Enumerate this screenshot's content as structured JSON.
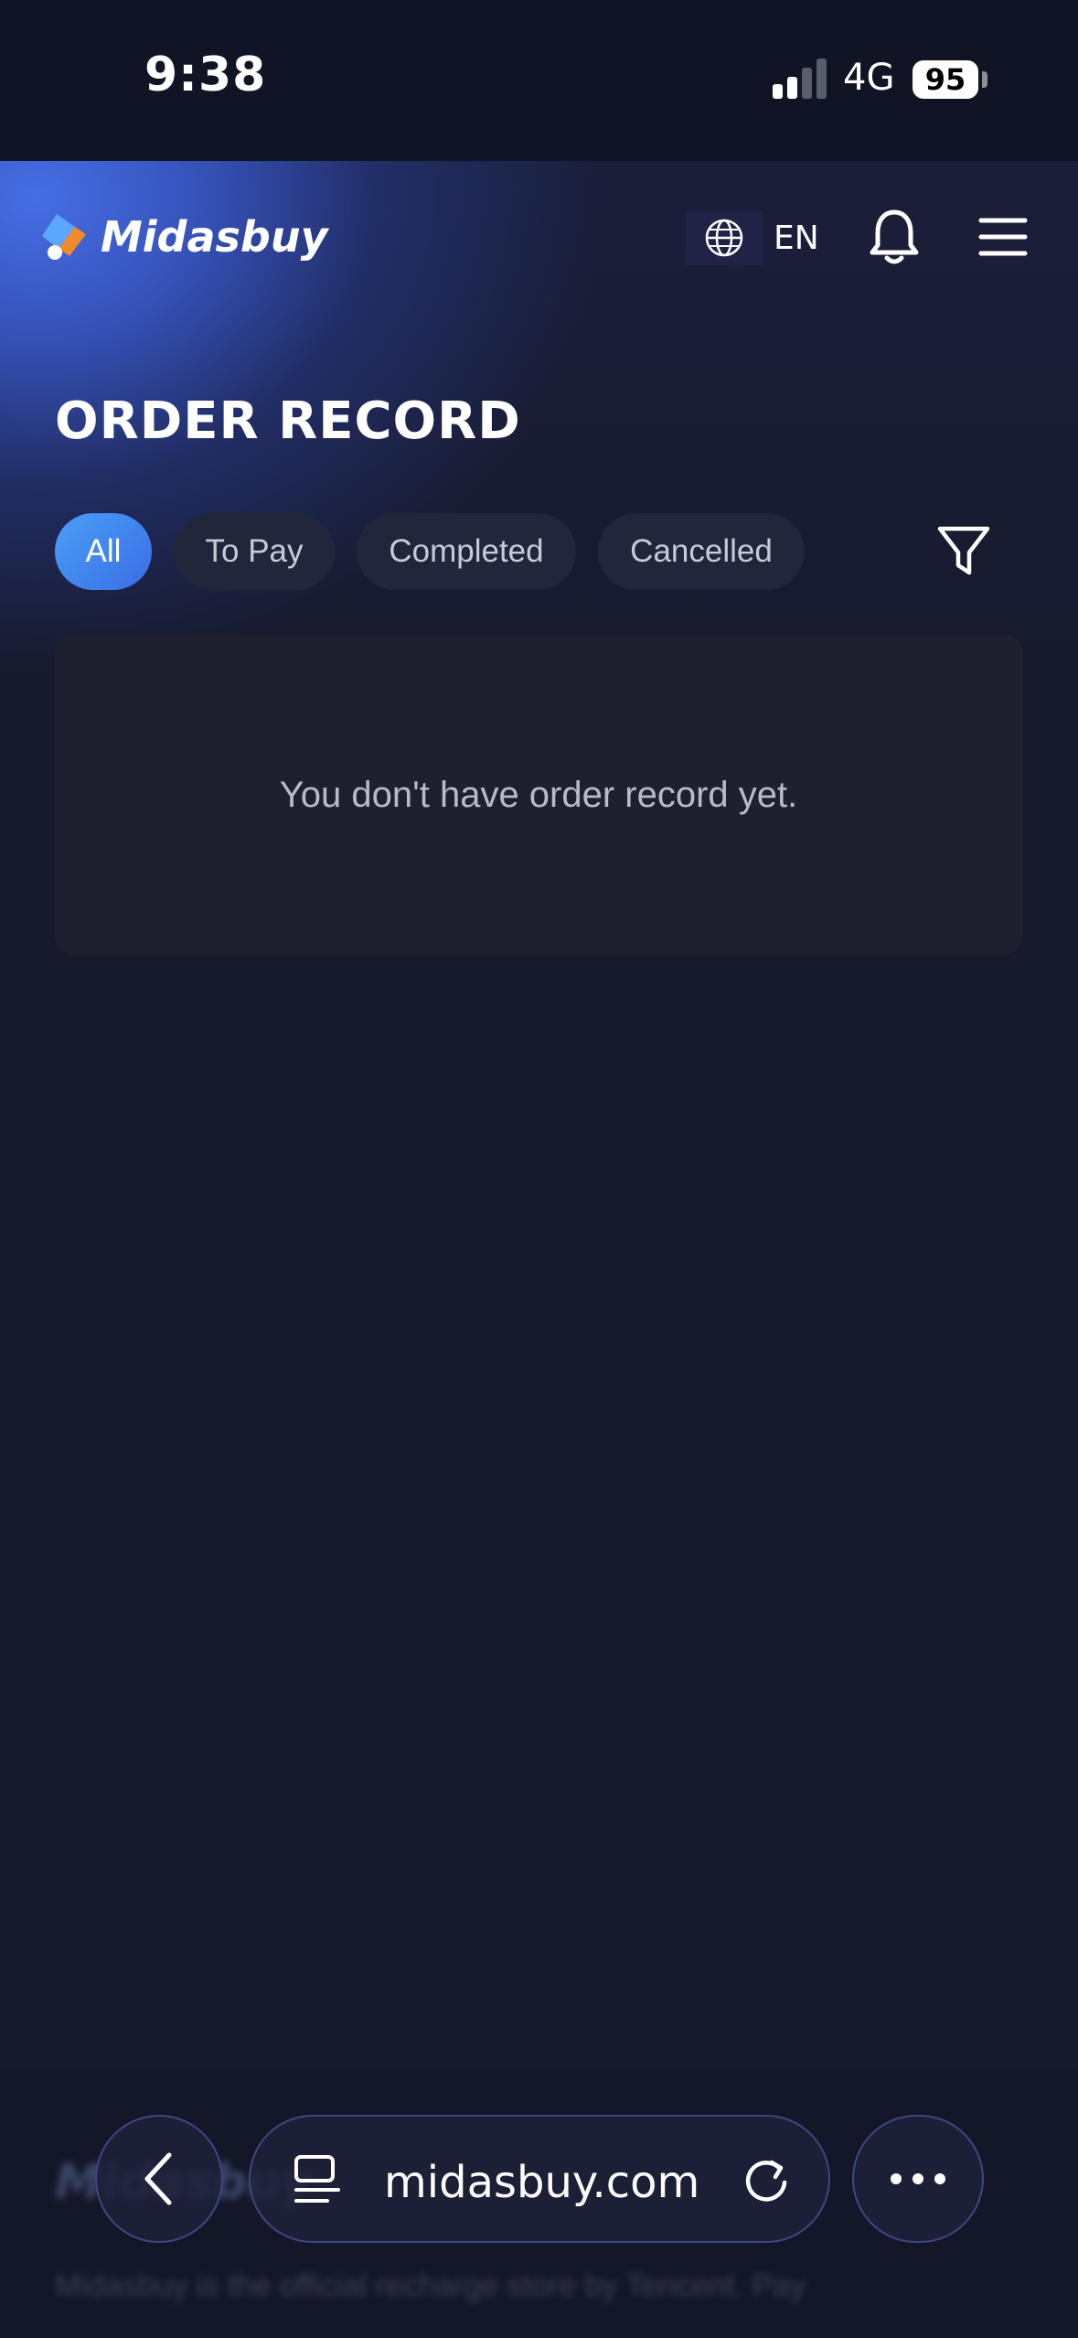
{
  "status_bar": {
    "time": "9:38",
    "network": "4G",
    "battery": "95"
  },
  "header": {
    "logo_text": "Midasbuy",
    "language": "EN"
  },
  "page": {
    "title": "ORDER RECORD"
  },
  "tabs": [
    {
      "label": "All",
      "active": true
    },
    {
      "label": "To Pay",
      "active": false
    },
    {
      "label": "Completed",
      "active": false
    },
    {
      "label": "Cancelled",
      "active": false
    }
  ],
  "empty_state": {
    "message": "You don't have order record yet."
  },
  "browser": {
    "url": "midasbuy.com"
  },
  "footer_blurred": {
    "logo_text": "Midasbuy",
    "text": "Midasbuy is the official recharge store by Tencent. Pay"
  },
  "colors": {
    "accent": "#3a6ce6",
    "background": "#171a2c",
    "tab_bg": "#22263a",
    "card_bg": "#1e2030"
  }
}
